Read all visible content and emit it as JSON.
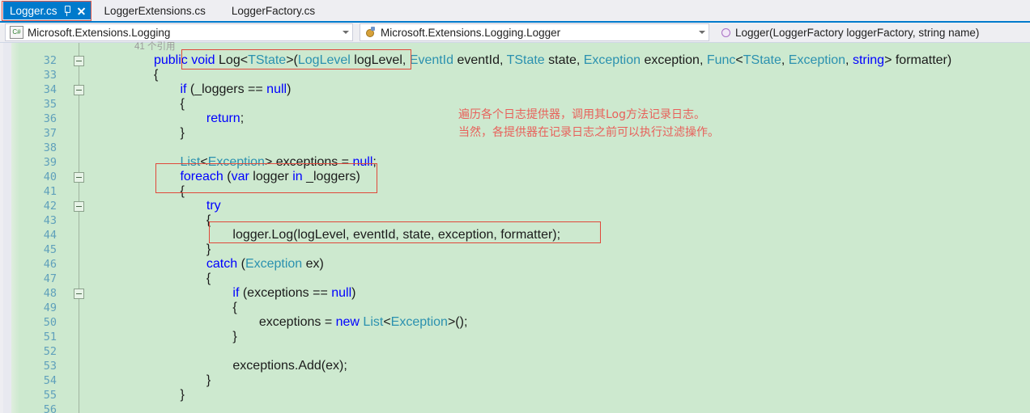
{
  "tabs": [
    {
      "label": "Logger.cs",
      "active": true,
      "pin_icon": "pin-icon",
      "close_icon": "close-icon"
    },
    {
      "label": "LoggerExtensions.cs",
      "active": false
    },
    {
      "label": "LoggerFactory.cs",
      "active": false
    }
  ],
  "navbar": {
    "project_selector": {
      "value": "Microsoft.Extensions.Logging",
      "icon": "csharp-file-icon"
    },
    "type_selector": {
      "value": "Microsoft.Extensions.Logging.Logger",
      "icon": "class-icon"
    },
    "member_selector": {
      "value": "Logger(LoggerFactory loggerFactory, string name)",
      "icon": "method-icon"
    }
  },
  "editor": {
    "codelens": "41 个引用",
    "first_line_number": 32,
    "lines": [
      {
        "n": 32,
        "fold": true,
        "indent": 8,
        "tokens": [
          {
            "t": "public",
            "c": "kw"
          },
          {
            "t": " ",
            "c": "plain"
          },
          {
            "t": "void",
            "c": "kw"
          },
          {
            "t": " Log<",
            "c": "plain"
          },
          {
            "t": "TState",
            "c": "type"
          },
          {
            "t": ">(",
            "c": "plain"
          },
          {
            "t": "LogLevel",
            "c": "type"
          },
          {
            "t": " logLevel, ",
            "c": "plain"
          },
          {
            "t": "EventId",
            "c": "type"
          },
          {
            "t": " eventId, ",
            "c": "plain"
          },
          {
            "t": "TState",
            "c": "type"
          },
          {
            "t": " state, ",
            "c": "plain"
          },
          {
            "t": "Exception",
            "c": "type"
          },
          {
            "t": " exception, ",
            "c": "plain"
          },
          {
            "t": "Func",
            "c": "type"
          },
          {
            "t": "<",
            "c": "plain"
          },
          {
            "t": "TState",
            "c": "type"
          },
          {
            "t": ", ",
            "c": "plain"
          },
          {
            "t": "Exception",
            "c": "type"
          },
          {
            "t": ", ",
            "c": "plain"
          },
          {
            "t": "string",
            "c": "kw"
          },
          {
            "t": "> formatter)",
            "c": "plain"
          }
        ]
      },
      {
        "n": 33,
        "fold": false,
        "indent": 8,
        "tokens": [
          {
            "t": "{",
            "c": "plain"
          }
        ]
      },
      {
        "n": 34,
        "fold": true,
        "indent": 12,
        "tokens": [
          {
            "t": "if",
            "c": "kw"
          },
          {
            "t": " (_loggers == ",
            "c": "plain"
          },
          {
            "t": "null",
            "c": "kw"
          },
          {
            "t": ")",
            "c": "plain"
          }
        ]
      },
      {
        "n": 35,
        "fold": false,
        "indent": 12,
        "tokens": [
          {
            "t": "{",
            "c": "plain"
          }
        ]
      },
      {
        "n": 36,
        "fold": false,
        "indent": 16,
        "tokens": [
          {
            "t": "return",
            "c": "kw"
          },
          {
            "t": ";",
            "c": "plain"
          }
        ]
      },
      {
        "n": 37,
        "fold": false,
        "indent": 12,
        "tokens": [
          {
            "t": "}",
            "c": "plain"
          }
        ]
      },
      {
        "n": 38,
        "fold": false,
        "indent": 12,
        "tokens": []
      },
      {
        "n": 39,
        "fold": false,
        "indent": 12,
        "tokens": [
          {
            "t": "List",
            "c": "type"
          },
          {
            "t": "<",
            "c": "plain"
          },
          {
            "t": "Exception",
            "c": "type"
          },
          {
            "t": "> exceptions = ",
            "c": "plain"
          },
          {
            "t": "null",
            "c": "kw"
          },
          {
            "t": ";",
            "c": "plain"
          }
        ]
      },
      {
        "n": 40,
        "fold": true,
        "indent": 12,
        "tokens": [
          {
            "t": "foreach",
            "c": "kw"
          },
          {
            "t": " (",
            "c": "plain"
          },
          {
            "t": "var",
            "c": "kw"
          },
          {
            "t": " logger ",
            "c": "plain"
          },
          {
            "t": "in",
            "c": "kw"
          },
          {
            "t": " _loggers)",
            "c": "plain"
          }
        ]
      },
      {
        "n": 41,
        "fold": false,
        "indent": 12,
        "tokens": [
          {
            "t": "{",
            "c": "plain"
          }
        ]
      },
      {
        "n": 42,
        "fold": true,
        "indent": 16,
        "tokens": [
          {
            "t": "try",
            "c": "kw"
          }
        ]
      },
      {
        "n": 43,
        "fold": false,
        "indent": 16,
        "tokens": [
          {
            "t": "{",
            "c": "plain"
          }
        ]
      },
      {
        "n": 44,
        "fold": false,
        "indent": 20,
        "tokens": [
          {
            "t": "logger.Log(logLevel, eventId, state, exception, formatter);",
            "c": "plain"
          }
        ]
      },
      {
        "n": 45,
        "fold": false,
        "indent": 16,
        "tokens": [
          {
            "t": "}",
            "c": "plain"
          }
        ]
      },
      {
        "n": 46,
        "fold": false,
        "indent": 16,
        "tokens": [
          {
            "t": "catch",
            "c": "kw"
          },
          {
            "t": " (",
            "c": "plain"
          },
          {
            "t": "Exception",
            "c": "type"
          },
          {
            "t": " ex)",
            "c": "plain"
          }
        ]
      },
      {
        "n": 47,
        "fold": false,
        "indent": 16,
        "tokens": [
          {
            "t": "{",
            "c": "plain"
          }
        ]
      },
      {
        "n": 48,
        "fold": true,
        "indent": 20,
        "tokens": [
          {
            "t": "if",
            "c": "kw"
          },
          {
            "t": " (exceptions == ",
            "c": "plain"
          },
          {
            "t": "null",
            "c": "kw"
          },
          {
            "t": ")",
            "c": "plain"
          }
        ]
      },
      {
        "n": 49,
        "fold": false,
        "indent": 20,
        "tokens": [
          {
            "t": "{",
            "c": "plain"
          }
        ]
      },
      {
        "n": 50,
        "fold": false,
        "indent": 24,
        "tokens": [
          {
            "t": "exceptions = ",
            "c": "plain"
          },
          {
            "t": "new",
            "c": "kw"
          },
          {
            "t": " ",
            "c": "plain"
          },
          {
            "t": "List",
            "c": "type"
          },
          {
            "t": "<",
            "c": "plain"
          },
          {
            "t": "Exception",
            "c": "type"
          },
          {
            "t": ">();",
            "c": "plain"
          }
        ]
      },
      {
        "n": 51,
        "fold": false,
        "indent": 20,
        "tokens": [
          {
            "t": "}",
            "c": "plain"
          }
        ]
      },
      {
        "n": 52,
        "fold": false,
        "indent": 20,
        "tokens": []
      },
      {
        "n": 53,
        "fold": false,
        "indent": 20,
        "tokens": [
          {
            "t": "exceptions.Add(ex);",
            "c": "plain"
          }
        ]
      },
      {
        "n": 54,
        "fold": false,
        "indent": 16,
        "tokens": [
          {
            "t": "}",
            "c": "plain"
          }
        ]
      },
      {
        "n": 55,
        "fold": false,
        "indent": 12,
        "tokens": [
          {
            "t": "}",
            "c": "plain"
          }
        ]
      },
      {
        "n": 56,
        "fold": false,
        "indent": 12,
        "tokens": []
      }
    ],
    "annotation_text_line1": "遍历各个日志提供器，调用其Log方法记录日志。",
    "annotation_text_line2": "当然，各提供器在记录日志之前可以执行过滤操作。"
  },
  "colors": {
    "editor_background": "#cde9cf",
    "annotation_red": "#e8605a",
    "box_red": "#e0483a",
    "keyword_blue": "#0000ff",
    "type_teal": "#2b91af",
    "line_number": "#5fa0bb",
    "active_tab_blue": "#007acc",
    "chrome_background": "#eeeef2"
  }
}
